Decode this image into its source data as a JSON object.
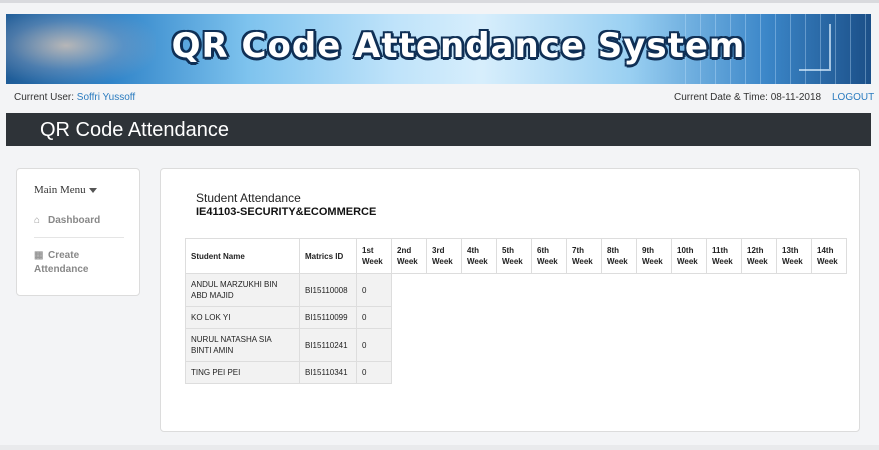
{
  "banner": {
    "title": "QR Code Attendance System"
  },
  "userbar": {
    "current_user_label": "Current User:",
    "current_user_name": "Soffri Yussoff",
    "datetime_label": "Current Date & Time:",
    "datetime_value": "08-11-2018",
    "logout_label": "LOGOUT"
  },
  "header": {
    "title": "QR Code Attendance"
  },
  "sidebar": {
    "menu_title": "Main Menu",
    "items": [
      {
        "label": "Dashboard",
        "icon": "home-icon"
      },
      {
        "label_line1": "Create",
        "label_line2": "Attendance",
        "icon": "calendar-icon"
      }
    ]
  },
  "main": {
    "label": "Student Attendance",
    "course": "IE41103-SECURITY&ECOMMERCE",
    "table": {
      "headers": {
        "name": "Student Name",
        "matrics": "Matrics ID",
        "weeks": [
          [
            "1st",
            "Week"
          ],
          [
            "2nd",
            "Week"
          ],
          [
            "3rd",
            "Week"
          ],
          [
            "4th",
            "Week"
          ],
          [
            "5th",
            "Week"
          ],
          [
            "6th",
            "Week"
          ],
          [
            "7th",
            "Week"
          ],
          [
            "8th",
            "Week"
          ],
          [
            "9th",
            "Week"
          ],
          [
            "10th",
            "Week"
          ],
          [
            "11th",
            "Week"
          ],
          [
            "12th",
            "Week"
          ],
          [
            "13th",
            "Week"
          ],
          [
            "14th",
            "Week"
          ]
        ]
      },
      "rows": [
        {
          "name_line1": "ANDUL MARZUKHI BIN",
          "name_line2": "ABD MAJID",
          "matrics": "BI15110008",
          "week1": "0"
        },
        {
          "name_line1": "KO LOK YI",
          "name_line2": "",
          "matrics": "BI15110099",
          "week1": "0"
        },
        {
          "name_line1": "NURUL NATASHA SIA",
          "name_line2": "BINTI AMIN",
          "matrics": "BI15110241",
          "week1": "0"
        },
        {
          "name_line1": "TING PEI PEI",
          "name_line2": "",
          "matrics": "BI15110341",
          "week1": "0"
        }
      ]
    }
  }
}
